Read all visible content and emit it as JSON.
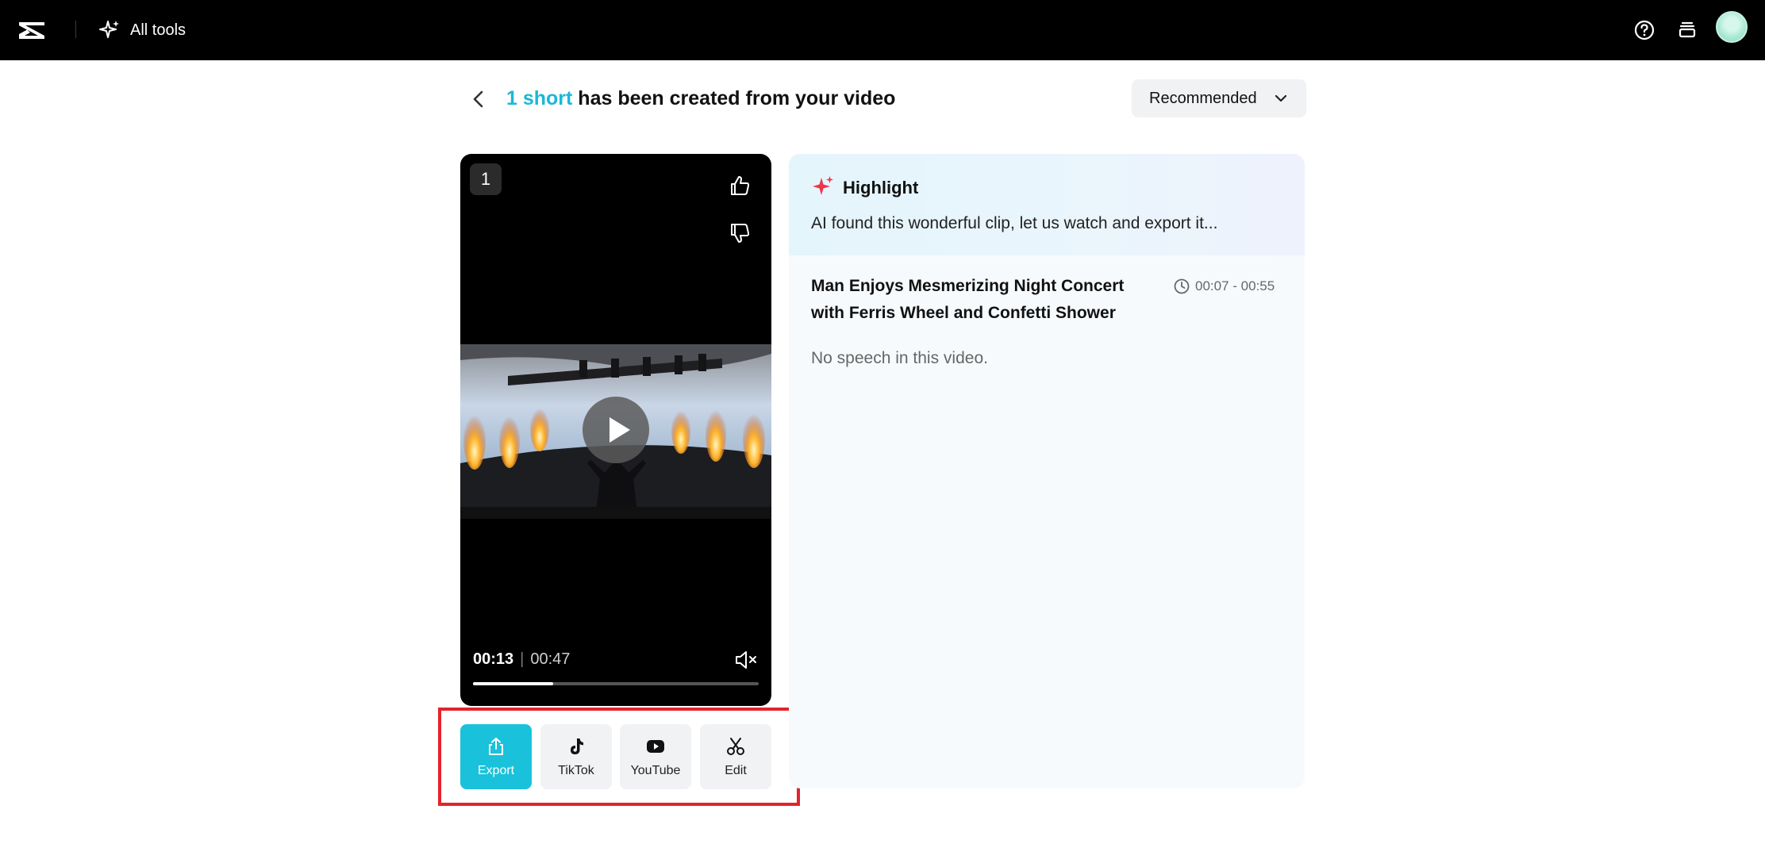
{
  "topbar": {
    "all_tools_label": "All tools"
  },
  "header": {
    "title_accent": "1 short",
    "title_rest": " has been created from your video",
    "sort_label": "Recommended"
  },
  "video": {
    "index_badge": "1",
    "current_time": "00:13",
    "duration": "00:47",
    "progress_fraction": 0.28
  },
  "actions": [
    {
      "label": "Export",
      "icon": "share-icon"
    },
    {
      "label": "TikTok",
      "icon": "tiktok-icon"
    },
    {
      "label": "YouTube",
      "icon": "youtube-icon"
    },
    {
      "label": "Edit",
      "icon": "scissors-icon"
    }
  ],
  "panel": {
    "highlight_title": "Highlight",
    "highlight_text": "AI found this wonderful clip, let us watch and export it...",
    "clip_title": "Man Enjoys Mesmerizing Night Concert with Ferris Wheel and Confetti Shower",
    "clip_range": "00:07 - 00:55",
    "clip_note": "No speech in this video."
  },
  "colors": {
    "accent": "#1ab8d7",
    "export_button": "#19c2da",
    "highlight_outline": "#e3232a",
    "spark": "#f2344b"
  }
}
